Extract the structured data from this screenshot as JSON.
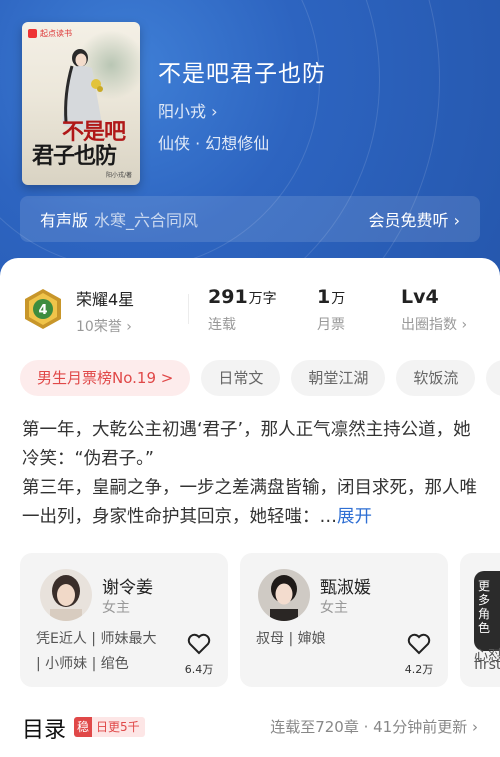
{
  "book": {
    "title": "不是吧君子也防",
    "author": "阳小戎",
    "genre": "仙侠 · 幻想修仙",
    "cover": {
      "brand": "起点读书",
      "title_line1": "不是吧",
      "title_line2": "君子也防",
      "author_small": "阳小戎/著"
    }
  },
  "audio": {
    "tag": "有声版",
    "narrator": "水寒_六合同风",
    "cta": "会员免费听"
  },
  "stats": {
    "honor": {
      "value": "荣耀4星",
      "label": "10荣誉",
      "level": "4"
    },
    "words": {
      "value": "291",
      "unit": "万字",
      "label": "连载"
    },
    "tickets": {
      "value": "1",
      "unit": "万",
      "label": "月票"
    },
    "influence": {
      "value": "Lv4",
      "label": "出圈指数"
    }
  },
  "tags": [
    "男生月票榜No.19 >",
    "日常文",
    "朝堂江湖",
    "软饭流",
    "..."
  ],
  "synopsis": {
    "text": "第一年，大乾公主初遇‘君子’，那人正气凛然主持公道，她冷笑：“伪君子。”\n第三年，皇嗣之争，一步之差满盘皆输，闭目求死，那人唯一出列，身家性命护其回京，她轻嗤：…",
    "more": "展开"
  },
  "characters": [
    {
      "name": "谢令姜",
      "role": "女主",
      "desc_line1": "凭E近人 | 师妹最大",
      "desc_line2": "| 小师妹 | 绾色",
      "likes": "6.4万"
    },
    {
      "name": "甄淑媛",
      "role": "女主",
      "desc_line1": "",
      "desc_line2": "叔母 | 婶娘",
      "likes": "4.2万"
    },
    {
      "name": "更多角色",
      "role": "",
      "desc_line1": "心怼",
      "desc_line2": "first",
      "likes": ""
    }
  ],
  "toc": {
    "heading": "目录",
    "update_badge": "稳",
    "update_text": "日更5千",
    "status": "连载至720章 · 41分钟前更新 ›"
  },
  "colors": {
    "header_bg": "#2d64c0",
    "accent_red": "#e04848",
    "link_blue": "#2f6fd3"
  }
}
